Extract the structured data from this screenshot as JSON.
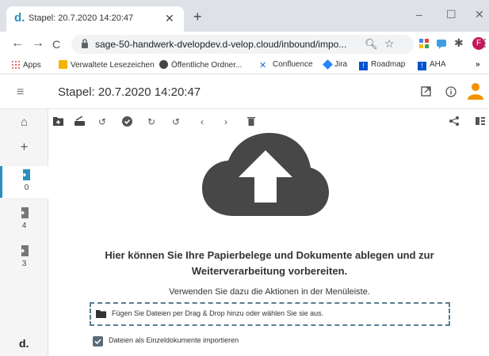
{
  "browser": {
    "tab_title": "Stapel: 20.7.2020 14:20:47",
    "tab_favicon_text": "d.",
    "new_tab": "+",
    "url": "sage-50-handwerk-dvelopdev.d-velop.cloud/inbound/impo...",
    "window_controls": {
      "minimize": "–",
      "maximize": "☐",
      "close": "✕"
    },
    "nav": {
      "back": "←",
      "forward": "→",
      "reload": "C"
    },
    "profile_initial": "F",
    "menu": "⋮"
  },
  "bookmarks": [
    {
      "label": "Apps",
      "icon": "apps-grid-icon",
      "color": "#e8453c"
    },
    {
      "label": "Verwaltete Lesezeichen",
      "icon": "managed-bookmarks-icon",
      "color": "#f4b400"
    },
    {
      "label": "Öffentliche Ordner...",
      "icon": "globe-icon",
      "color": "#444444"
    },
    {
      "label": "Confluence",
      "icon": "confluence-icon",
      "color": "#1868db"
    },
    {
      "label": "Jira",
      "icon": "jira-icon",
      "color": "#2684ff"
    },
    {
      "label": "Roadmap",
      "icon": "roadmap-icon",
      "color": "#0052cc"
    },
    {
      "label": "AHA",
      "icon": "aha-icon",
      "color": "#0052cc"
    }
  ],
  "bookmarks_more": "»",
  "app": {
    "page_title": "Stapel: 20.7.2020 14:20:47",
    "accent": "#2a8fbd",
    "avatar_color": "#f39200",
    "sidebar": {
      "inboxes": [
        {
          "count": "0",
          "selected": true
        },
        {
          "count": "4",
          "selected": false
        },
        {
          "count": "3",
          "selected": false
        }
      ],
      "logo": "d."
    },
    "main": {
      "message": "Hier können Sie Ihre Papierbelege und Dokumente ablegen und zur Weiterverarbeitung vorbereiten.",
      "hint": "Verwenden Sie dazu die Aktionen in der Menüleiste.",
      "dropzone_text": "Fügen Sie Dateien per Drag & Drop hinzu oder wählen Sie sie aus.",
      "checkbox_label": "Dateien als Einzeldokumente importieren",
      "checkbox_checked": true
    }
  }
}
